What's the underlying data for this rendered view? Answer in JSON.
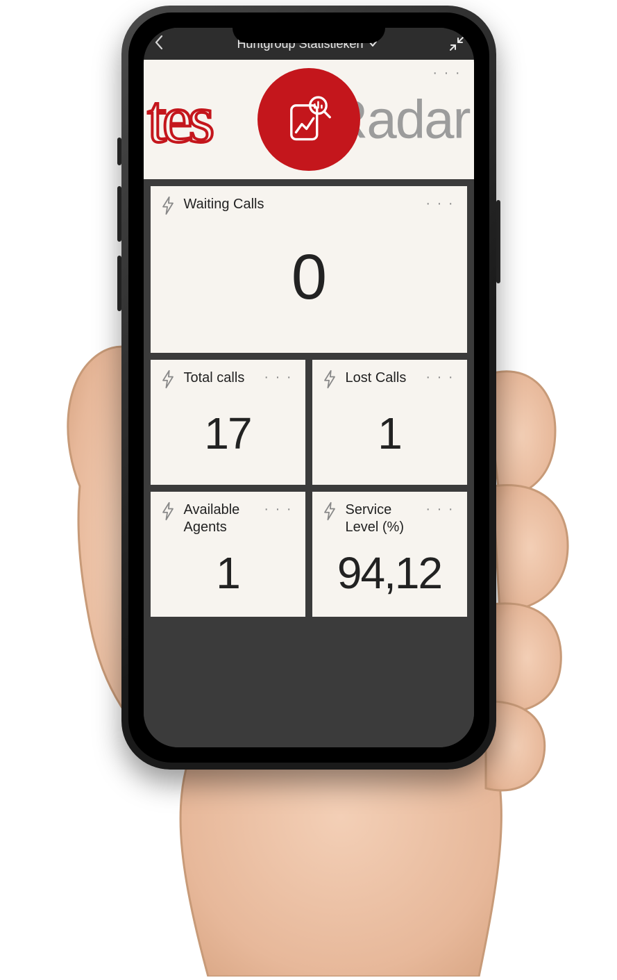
{
  "navbar": {
    "title": "Huntgroup Statistieken"
  },
  "banner": {
    "left_text": "tes",
    "right_text": "Radar",
    "menu_dots": "· · ·"
  },
  "cards": {
    "waiting": {
      "label": "Waiting Calls",
      "value": "0"
    },
    "total": {
      "label": "Total calls",
      "value": "17"
    },
    "lost": {
      "label": "Lost Calls",
      "value": "1"
    },
    "agents": {
      "label": "Available Agents",
      "value": "1"
    },
    "service": {
      "label": "Service Level (%)",
      "value": "94,12"
    }
  },
  "menu_dots": "· · ·",
  "colors": {
    "brand_red": "#c4161c",
    "card_bg": "#f7f4ef",
    "dash_bg": "#3b3b3b"
  }
}
